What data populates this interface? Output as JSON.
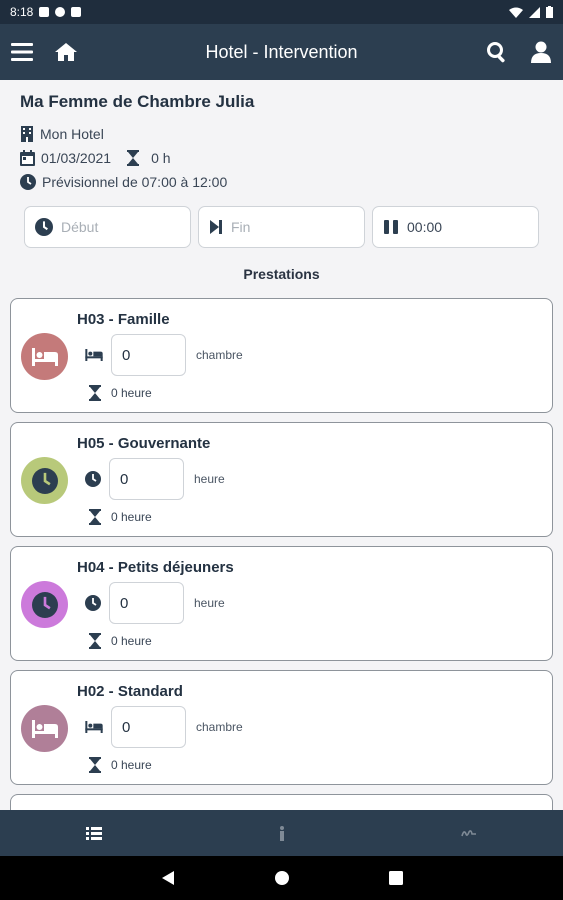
{
  "status_bar": {
    "time": "8:18"
  },
  "app_bar": {
    "title": "Hotel - Intervention"
  },
  "header": {
    "agent": "Ma Femme de Chambre Julia",
    "hotel": "Mon Hotel",
    "date": "01/03/2021",
    "duration": "0 h",
    "planned": "Prévisionnel de 07:00 à 12:00"
  },
  "time_fields": {
    "start_placeholder": "Début",
    "end_placeholder": "Fin",
    "pause_value": "00:00"
  },
  "section_title": "Prestations",
  "cards": [
    {
      "title": "H03 - Famille",
      "qty": "0",
      "unit": "chambre",
      "hours": "0 heure",
      "icon": "bed-icon",
      "color": "#c47a7a"
    },
    {
      "title": "H05 - Gouvernante",
      "qty": "0",
      "unit": "heure",
      "hours": "0 heure",
      "icon": "clock-icon",
      "color": "#b8c97a"
    },
    {
      "title": "H04 - Petits déjeuners",
      "qty": "0",
      "unit": "heure",
      "hours": "0 heure",
      "icon": "clock-icon",
      "color": "#cc7adb"
    },
    {
      "title": "H02 - Standard",
      "qty": "0",
      "unit": "chambre",
      "hours": "0 heure",
      "icon": "bed-icon",
      "color": "#b07f98"
    }
  ],
  "bottom_nav": [
    {
      "icon": "list-icon"
    },
    {
      "icon": "info-icon"
    },
    {
      "icon": "signature-icon"
    }
  ],
  "colors": {
    "app_bar": "#2c3e50",
    "text": "#243242",
    "card_border": "#8e949b"
  }
}
